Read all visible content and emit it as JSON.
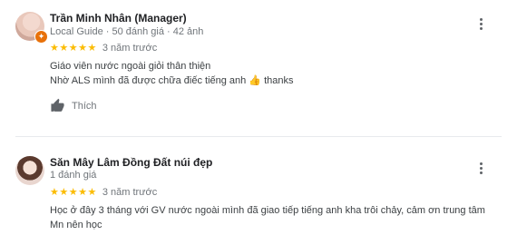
{
  "reviews": [
    {
      "name": "Trần Minh Nhân (Manager)",
      "meta": "Local Guide · 50 đánh giá · 42 ảnh",
      "stars": "★★★★★",
      "time": "3 năm trước",
      "lines": [
        "Giáo viên nước ngoài giỏi thân thiện",
        "Nhờ ALS mình đã được chữa điếc tiếng anh"
      ],
      "line2_suffix": "thanks",
      "emoji": "👍",
      "like_label": "Thích"
    },
    {
      "name": "Săn Mây Lâm Đồng Đất núi đẹp",
      "meta": "1 đánh giá",
      "stars": "★★★★★",
      "time": "3 năm trước",
      "lines": [
        "Học ở đây 3 tháng với GV nước ngoài mình đã giao tiếp tiếng anh kha trôi chảy, cảm ơn trung tâm",
        "Mn nên học"
      ]
    }
  ],
  "colors": {
    "star": "#fbbc04",
    "local_guide_badge": "#e8710a"
  },
  "icons": {
    "more": "more-vert-icon",
    "like": "thumb-up-icon",
    "guide": "local-guide-badge-icon"
  }
}
